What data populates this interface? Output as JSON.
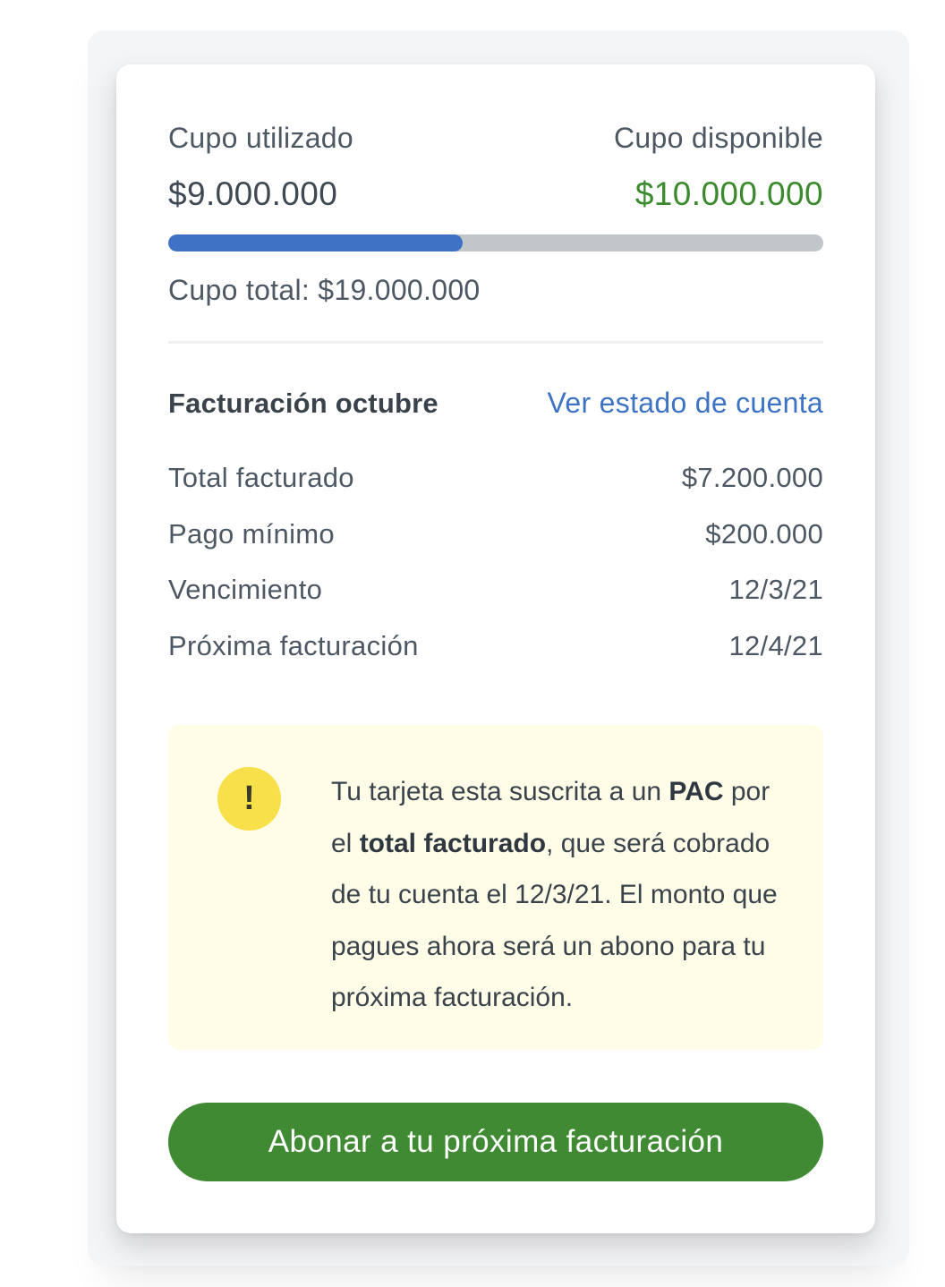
{
  "quota": {
    "used_label": "Cupo utilizado",
    "available_label": "Cupo disponible",
    "used_amount": "$9.000.000",
    "available_amount": "$10.000.000",
    "usage_fraction": 0.45,
    "total_text": "Cupo total: $19.000.000"
  },
  "billing": {
    "title": "Facturación octubre",
    "statement_link": "Ver estado de cuenta",
    "rows": [
      {
        "label": "Total facturado",
        "value": "$7.200.000"
      },
      {
        "label": "Pago mínimo",
        "value": "$200.000"
      },
      {
        "label": "Vencimiento",
        "value": "12/3/21"
      },
      {
        "label": "Próxima facturación",
        "value": "12/4/21"
      }
    ]
  },
  "alert": {
    "icon": "exclamation-icon",
    "icon_glyph": "!",
    "part1": "Tu tarjeta esta suscrita a un ",
    "bold1": "PAC",
    "part2": " por el ",
    "bold2": "total facturado",
    "part3": ", que será cobrado de tu cuenta el 12/3/21. El monto que pagues ahora será un abono para tu próxima facturación."
  },
  "cta": {
    "label": "Abonar a tu próxima facturación"
  },
  "colors": {
    "primary_blue": "#3d72c4",
    "available_green": "#3c8a2e",
    "button_green": "#3f8a32",
    "alert_yellow": "#f8e04a",
    "alert_bg": "#fffce8"
  }
}
